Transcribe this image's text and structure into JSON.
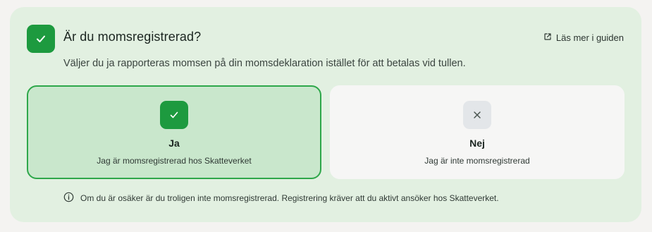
{
  "question": {
    "title": "Är du momsregistrerad?",
    "subtitle": "Väljer du ja rapporteras momsen på din momsdeklaration istället för att betalas vid tullen.",
    "guide_link": "Läs mer i guiden",
    "status_icon": "check-icon"
  },
  "options": [
    {
      "label": "Ja",
      "description": "Jag är momsregistrerad hos Skatteverket",
      "icon": "check-icon",
      "selected": true
    },
    {
      "label": "Nej",
      "description": "Jag är inte momsregistrerad",
      "icon": "close-icon",
      "selected": false
    }
  ],
  "info": {
    "icon": "info-icon",
    "text": "Om du är osäker är du troligen inte momsregistrerad. Registrering kräver att du aktivt ansöker hos Skatteverket."
  },
  "colors": {
    "accent": "#1d9a3f",
    "card_background": "#e2f0e1",
    "selected_background": "#c9e7cc",
    "selected_border": "#2ea74a",
    "unselected_background": "#f6f6f5"
  }
}
